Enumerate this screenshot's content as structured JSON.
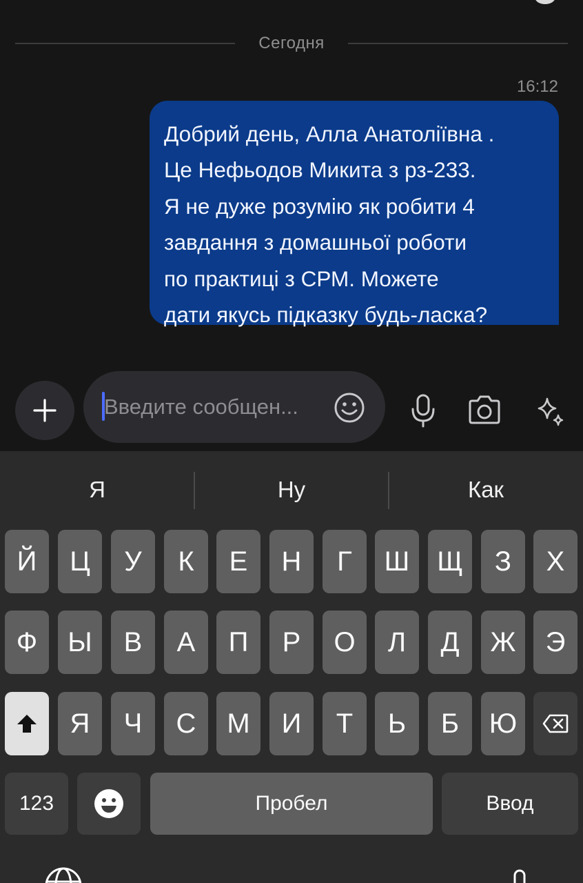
{
  "chat": {
    "date_separator": "Сегодня",
    "message": {
      "time": "16:12",
      "text": "Добрий день, Алла Анатоліївна .\nЦе Нефьодов Микита з рз-233.\nЯ не дуже розумію як робити 4\nзавдання з домашньої роботи\nпо практиці з СРМ. Можете\nдати якусь підказку будь-ласка?"
    }
  },
  "composer": {
    "placeholder": "Введите сообщен...",
    "accent_color": "#0b3b8a",
    "icons": [
      "plus-icon",
      "emoji-icon",
      "microphone-icon",
      "camera-icon",
      "ai-sparkle-icon"
    ]
  },
  "keyboard": {
    "suggestions": [
      "Я",
      "Ну",
      "Как"
    ],
    "row1": [
      "Й",
      "Ц",
      "У",
      "К",
      "Е",
      "Н",
      "Г",
      "Ш",
      "Щ",
      "З",
      "Х"
    ],
    "row2": [
      "Ф",
      "Ы",
      "В",
      "А",
      "П",
      "Р",
      "О",
      "Л",
      "Д",
      "Ж",
      "Э"
    ],
    "row3": [
      "Я",
      "Ч",
      "С",
      "М",
      "И",
      "Т",
      "Ь",
      "Б",
      "Ю"
    ],
    "numbers_label": "123",
    "space_label": "Пробел",
    "enter_label": "Ввод"
  }
}
